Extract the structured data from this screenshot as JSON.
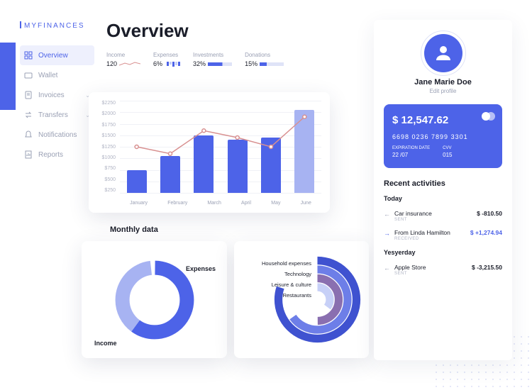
{
  "brand": "MYFINANCES",
  "nav": [
    {
      "label": "Overview",
      "icon": "grid",
      "active": true
    },
    {
      "label": "Wallet",
      "icon": "wallet"
    },
    {
      "label": "Invoices",
      "icon": "doc",
      "chev": true
    },
    {
      "label": "Transfers",
      "icon": "swap",
      "chev": true
    },
    {
      "label": "Notifications",
      "icon": "bell"
    },
    {
      "label": "Reports",
      "icon": "report"
    }
  ],
  "page_title": "Overview",
  "stats": {
    "income": {
      "label": "Income",
      "value": "120"
    },
    "expenses": {
      "label": "Expenses",
      "value": "6%"
    },
    "investments": {
      "label": "Investments",
      "value": "32%"
    },
    "donations": {
      "label": "Donations",
      "value": "15%"
    }
  },
  "monthly_title": "Monthly data",
  "donut": {
    "label_expenses": "Expenses",
    "label_income": "Income"
  },
  "radial": {
    "labels": [
      "Household expenses",
      "Technology",
      "Leisure & culture",
      "Restaurants"
    ]
  },
  "user": {
    "name": "Jane Marie Doe",
    "edit": "Edit profile"
  },
  "card": {
    "balance": "$ 12,547.62",
    "number": "6698 0236 7899 3301",
    "exp_lbl": "EXPIRATION DATE",
    "exp": "22 /07",
    "cvv_lbl": "CVV",
    "cvv": "015"
  },
  "recent": {
    "title": "Recent activities",
    "groups": [
      {
        "day": "Today",
        "items": [
          {
            "dir": "out",
            "name": "Car insurance",
            "type": "SENT",
            "amount": "$ -810.50"
          },
          {
            "dir": "in",
            "name": "From Linda Hamilton",
            "type": "RECEIVED",
            "amount": "$ +1,274.94"
          }
        ]
      },
      {
        "day": "Yesyerday",
        "items": [
          {
            "dir": "out",
            "name": "Apple Store",
            "type": "SENT",
            "amount": "$ -3,215.50"
          }
        ]
      }
    ]
  },
  "chart_data": {
    "bar_chart": {
      "type": "bar-with-line",
      "categories": [
        "January",
        "February",
        "March",
        "April",
        "May",
        "June"
      ],
      "bars": [
        750,
        1050,
        1500,
        1400,
        1450,
        2050
      ],
      "line": [
        1250,
        1100,
        1600,
        1450,
        1250,
        1900
      ],
      "ylim": [
        250,
        2250
      ],
      "y_ticks": [
        2250,
        2000,
        1750,
        1500,
        1250,
        1000,
        750,
        500,
        250
      ]
    },
    "donut": {
      "type": "pie",
      "series": [
        {
          "name": "Expenses",
          "value": 40
        },
        {
          "name": "Income",
          "value": 60
        }
      ]
    },
    "radial": {
      "type": "radial-bar",
      "series": [
        {
          "name": "Household expenses",
          "value": 80
        },
        {
          "name": "Technology",
          "value": 65
        },
        {
          "name": "Leisure & culture",
          "value": 50
        },
        {
          "name": "Restaurants",
          "value": 35
        }
      ]
    }
  },
  "colors": {
    "primary": "#4d63e8",
    "primary_light": "#a7b3f2",
    "muted": "#9aa0b4",
    "accent": "#8a6fb0"
  }
}
